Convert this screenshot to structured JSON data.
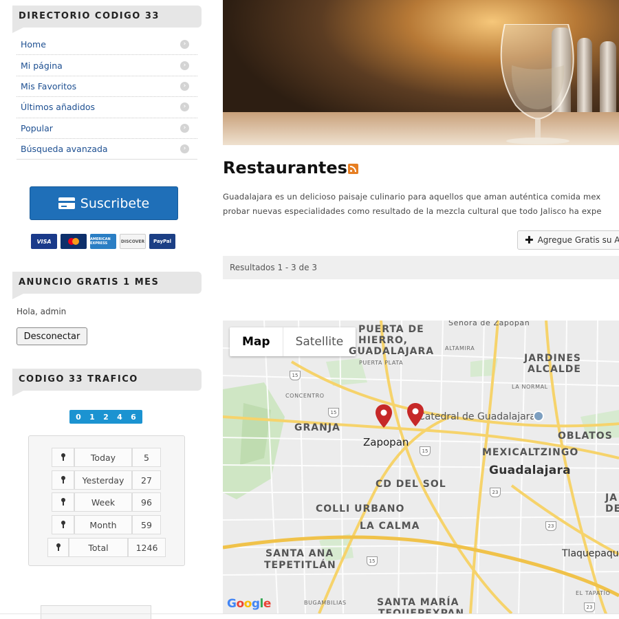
{
  "sidebar": {
    "directory_title": "DIRECTORIO CODIGO 33",
    "menu": [
      {
        "label": "Home"
      },
      {
        "label": "Mi página"
      },
      {
        "label": "Mis Favoritos"
      },
      {
        "label": "Últimos añadidos"
      },
      {
        "label": "Popular"
      },
      {
        "label": "Búsqueda avanzada"
      }
    ],
    "subscribe_label": "Suscribete",
    "payment_methods": [
      "VISA",
      "MasterCard",
      "AMERICAN EXPRESS",
      "DISCOVER",
      "PayPal"
    ],
    "ad_title": "ANUNCIO GRATIS 1 MES",
    "greeting": "Hola, admin",
    "logout_label": "Desconectar",
    "traffic_title": "CODIGO 33 TRAFICO",
    "counter_digits": [
      "0",
      "1",
      "2",
      "4",
      "6"
    ],
    "stats": [
      {
        "label": "Today",
        "value": "5"
      },
      {
        "label": "Yesterday",
        "value": "27"
      },
      {
        "label": "Week",
        "value": "96"
      },
      {
        "label": "Month",
        "value": "59"
      },
      {
        "label": "Total",
        "value": "1246"
      }
    ]
  },
  "main": {
    "title": "Restaurantes",
    "intro_line1": "Guadalajara es un delicioso paisaje culinario para aquellos que aman auténtica comida mex",
    "intro_line2": "probar nuevas especialidades como resultado de la mezcla cultural que todo Jalisco ha expe",
    "add_button_label": "Agregue Gratis su A",
    "results_text": "Resultados 1 - 3 de 3"
  },
  "map": {
    "tab_map": "Map",
    "tab_satellite": "Satellite",
    "google_logo": "Google",
    "labels": {
      "senora": "Señora de Zapopan",
      "puerta1": "PUERTA DE",
      "puerta2": "HIERRO,",
      "puerta3": "GUADALAJARA",
      "puerta_plata": "PUERTA PLATA",
      "altamira": "ALTAMIRA",
      "jardines1": "JARDINES",
      "jardines2": "ALCALDE",
      "concentro": "CONCENTRO",
      "la_normal": "LA NORMAL",
      "granja": "GRANJA",
      "catedral": "Catedral de Guadalajara",
      "oblatos": "OBLATOS",
      "zapopan": "Zapopan",
      "mexicaltzingo": "MEXICALTZINGO",
      "guadalajara": "Guadalajara",
      "cd_del_sol": "CD DEL SOL",
      "colli": "COLLI URBANO",
      "ja": "JA",
      "de": "DE",
      "la_calma": "LA CALMA",
      "santa_ana1": "SANTA ANA",
      "santa_ana2": "TEPETITLÁN",
      "tlaquepaque": "Tlaquepaqu",
      "el_tapatio": "EL TAPATÍO",
      "bugambilias": "BUGAMBILIAS",
      "santa_maria1": "SANTA MARÍA",
      "santa_maria2": "TEQUEPEXPAN"
    },
    "road_shields": [
      "15",
      "15",
      "15",
      "23",
      "23",
      "15",
      "23"
    ]
  },
  "colors": {
    "link": "#1d4f91",
    "subscribe": "#1f6fb8",
    "counter": "#1b93d1",
    "marker": "#c62828",
    "rss": "#e67e22"
  }
}
